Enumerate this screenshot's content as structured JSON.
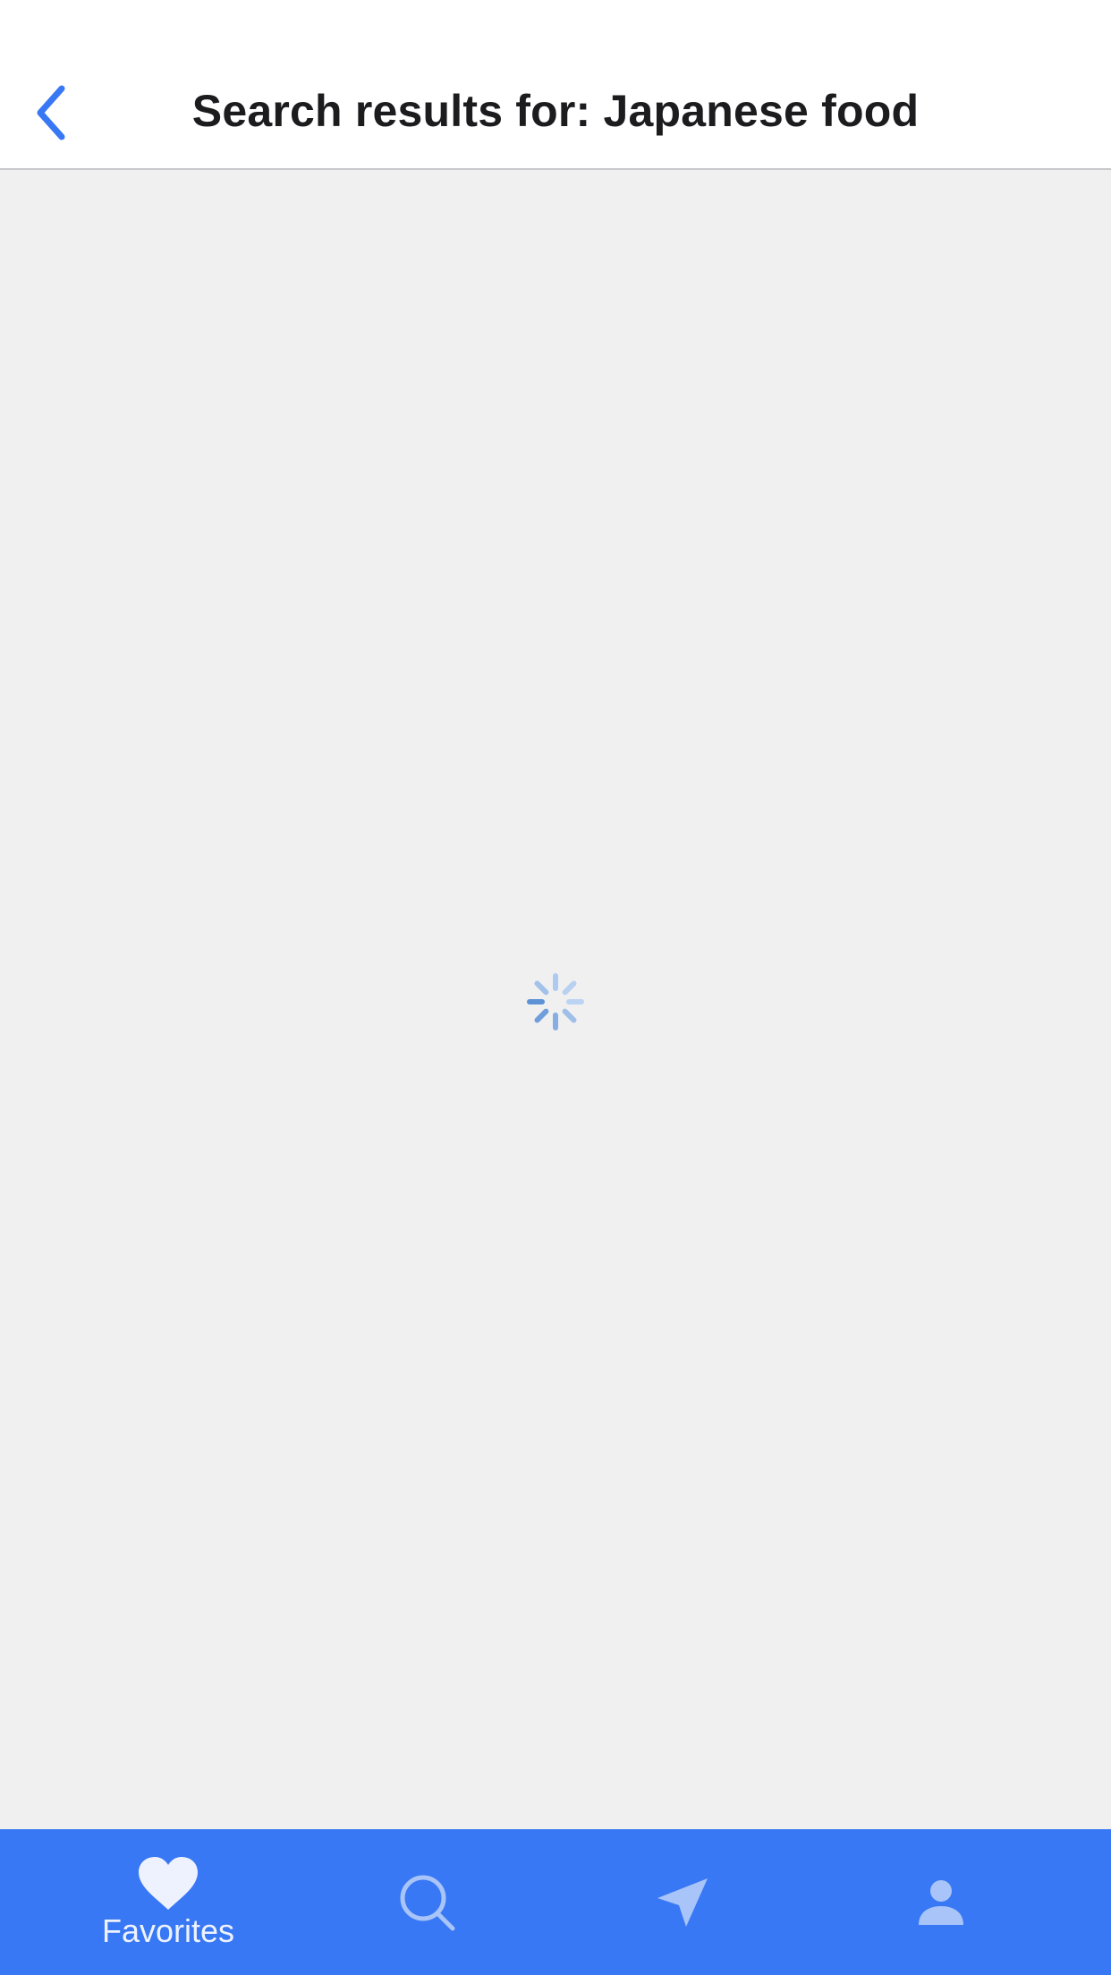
{
  "header": {
    "title": "Search results for: Japanese food",
    "back_icon": "chevron-left-icon"
  },
  "status": {
    "loading": true,
    "spinner_icon": "activity-spinner-icon"
  },
  "tabbar": {
    "items": [
      {
        "label": "Favorites",
        "icon": "heart-icon",
        "active": true
      },
      {
        "label": "",
        "icon": "search-icon",
        "active": false
      },
      {
        "label": "",
        "icon": "location-arrow-icon",
        "active": false
      },
      {
        "label": "",
        "icon": "person-icon",
        "active": false
      }
    ]
  },
  "colors": {
    "accent": "#3878f4",
    "background": "#f0f0f1",
    "header_bg": "#ffffff",
    "title_text": "#1c1c1e",
    "tab_active": "#eef2ff",
    "tab_inactive": "#a8c4f8"
  }
}
